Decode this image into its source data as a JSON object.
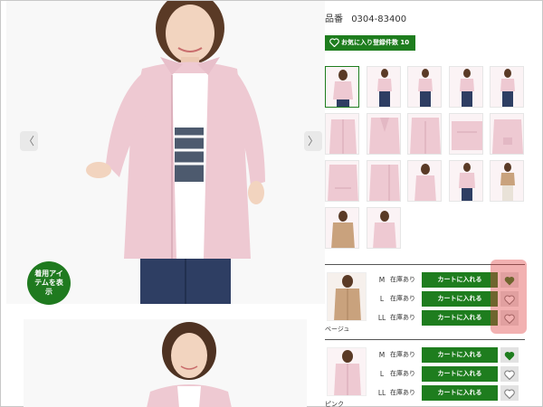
{
  "product": {
    "sku_label": "品番",
    "sku_value": "0304-83400",
    "fav_count_button": "お気に入り登録件数 10件"
  },
  "gallery": {
    "prev_arrow": "〈",
    "next_arrow": "〉",
    "wear_badge": "着用アイテムを表示",
    "thumbnail_count": 17
  },
  "colors": [
    {
      "name": "ベージュ",
      "rows": [
        {
          "size": "M",
          "stock": "在庫あり",
          "cart": "カートに入れる",
          "favorited": true
        },
        {
          "size": "L",
          "stock": "在庫あり",
          "cart": "カートに入れる",
          "favorited": false
        },
        {
          "size": "LL",
          "stock": "在庫あり",
          "cart": "カートに入れる",
          "favorited": false
        }
      ]
    },
    {
      "name": "ピンク",
      "rows": [
        {
          "size": "M",
          "stock": "在庫あり",
          "cart": "カートに入れる",
          "favorited": true
        },
        {
          "size": "L",
          "stock": "在庫あり",
          "cart": "カートに入れる",
          "favorited": false
        },
        {
          "size": "LL",
          "stock": "在庫あり",
          "cart": "カートに入れる",
          "favorited": false
        }
      ]
    }
  ],
  "colors_theme": {
    "accent_green": "#1e7d1e",
    "jacket_pink": "#eec9d2",
    "jacket_beige": "#c9a27d",
    "highlight_red": "#e14646"
  }
}
